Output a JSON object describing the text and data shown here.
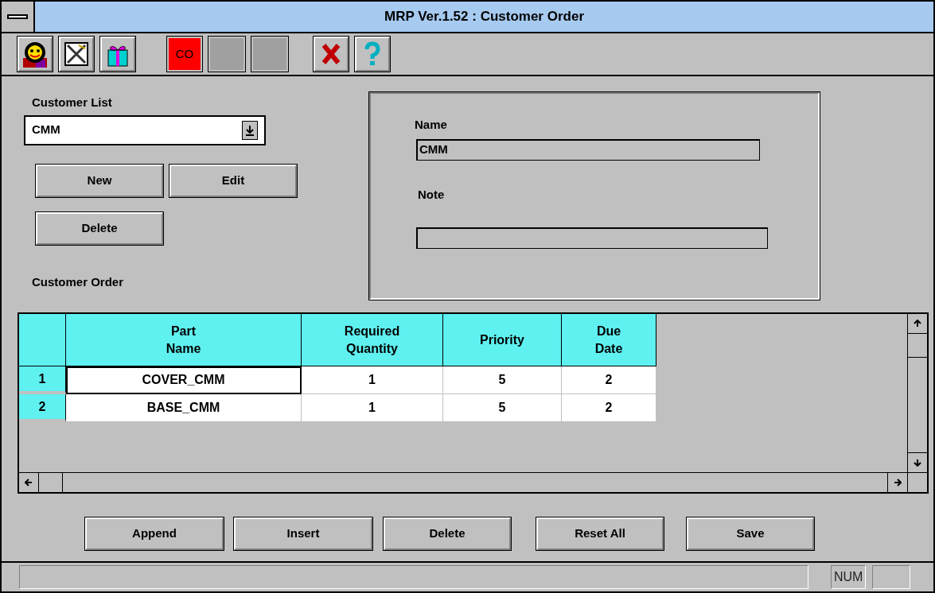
{
  "window": {
    "title": "MRP Ver.1.52 : Customer Order"
  },
  "toolbar": {
    "order_button": "CO"
  },
  "customer_list": {
    "label": "Customer List",
    "value": "CMM"
  },
  "customer_buttons": [
    "New",
    "Edit",
    "Delete"
  ],
  "details": {
    "name_label": "Name",
    "name_value": "CMM",
    "note_label": "Note"
  },
  "order_label": "Customer Order",
  "table": {
    "columns": [
      "Part Name",
      "Required Quantity",
      "Priority",
      "Due Date"
    ],
    "rows": [
      {
        "number": "1",
        "cells": [
          "COVER_CMM",
          "1",
          "5",
          "2"
        ],
        "focused": true
      },
      {
        "number": "2",
        "cells": [
          "BASE_CMM",
          "1",
          "5",
          "2"
        ],
        "focused": false
      }
    ]
  },
  "actions": [
    "Append",
    "Insert",
    "Delete",
    "Reset All",
    "Save"
  ],
  "status_bar": {
    "indicator": "NUM"
  }
}
